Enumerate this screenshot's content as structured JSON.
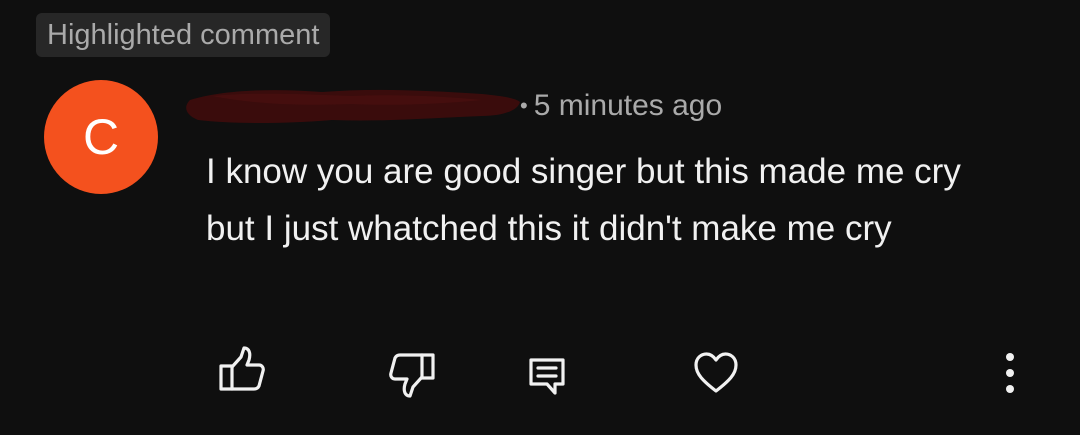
{
  "badge": {
    "label": "Highlighted comment"
  },
  "comment": {
    "avatar_letter": "C",
    "author_name": "",
    "author_name_redacted": true,
    "separator": "•",
    "timestamp": "5 minutes ago",
    "text": "I know you are good singer but this made me cry but I just whatched this it didn't make me cry"
  },
  "actions": {
    "icons": [
      "thumbs-up-icon",
      "thumbs-down-icon",
      "reply-icon",
      "heart-icon",
      "more-vert-icon"
    ]
  },
  "colors": {
    "background": "#0f0f0f",
    "badge_background": "#272727",
    "badge_text": "#aaaaaa",
    "avatar": "#f4511e",
    "primary_text": "#f1f1f1",
    "secondary_text": "#aaaaaa",
    "redaction": "#3a0c0c"
  }
}
